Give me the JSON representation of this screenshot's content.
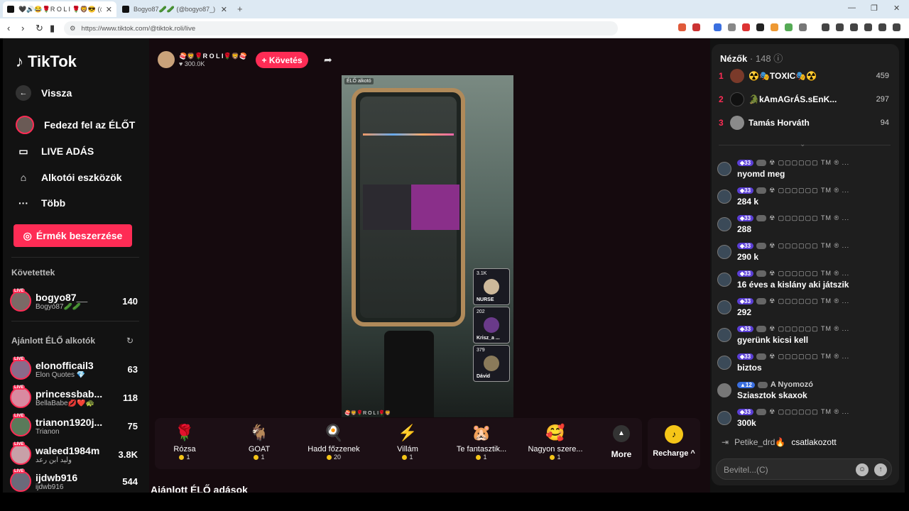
{
  "browser": {
    "tabs": [
      {
        "label": "🖤🔊😂🌹R O L I 🌹🦁😎 (@tiktok.roli)"
      },
      {
        "label": "Bogyo87🥒🥒 (@bogyo87_) ÉLŐ a"
      }
    ],
    "url": "https://www.tiktok.com/@tiktok.roli/live"
  },
  "sidebar": {
    "logo": "TikTok",
    "back": "Vissza",
    "menu": [
      {
        "label": "Fedezd fel az ÉLŐT"
      },
      {
        "label": "LIVE ADÁS"
      },
      {
        "label": "Alkotói eszközök"
      },
      {
        "label": "Több"
      }
    ],
    "coins_button": "Érmék beszerzése",
    "following_title": "Követettek",
    "following": [
      {
        "name": "bogyo87__",
        "sub": "Bogyó87🥒🥒",
        "count": "140"
      }
    ],
    "recommended_title": "Ajánlott ÉLŐ alkotók",
    "live_badge": "LIVE",
    "recommended": [
      {
        "name": "elonofficail3",
        "sub": "Elon Quotes 💎",
        "count": "63"
      },
      {
        "name": "princessbab...",
        "sub": "BellaBabe💋❤️🐢",
        "count": "118"
      },
      {
        "name": "trianon1920j...",
        "sub": "Trianon",
        "count": "75"
      },
      {
        "name": "waleed1984m",
        "sub": "وليد ابن رعد",
        "count": "3.8K"
      },
      {
        "name": "ijdwb916",
        "sub": "ijdwb916",
        "count": "544"
      }
    ]
  },
  "stream": {
    "streamer_name": "🍣🦁🌹R O L I🌹🦁🍣",
    "likes": "300.0K",
    "follow_button": "+ Követés",
    "video_badge": "ÉLŐ alkotó",
    "video_footer": "🍣🦁🌹R O L I🌹🦁",
    "guests": [
      {
        "count": "3.1K",
        "name": "NURSE"
      },
      {
        "count": "202",
        "name": "Krisz_a ..."
      },
      {
        "count": "379",
        "name": "Dávid"
      }
    ],
    "gifts": [
      {
        "name": "Rózsa",
        "price": "1",
        "icon": "🌹"
      },
      {
        "name": "GOAT",
        "price": "1",
        "icon": "🐐"
      },
      {
        "name": "Hadd főzzenek",
        "price": "20",
        "icon": "🍳"
      },
      {
        "name": "Villám",
        "price": "1",
        "icon": "⚡"
      },
      {
        "name": "Te fantasztik...",
        "price": "1",
        "icon": "🐹"
      },
      {
        "name": "Nagyon szere...",
        "price": "1",
        "icon": "🥰"
      }
    ],
    "more_label": "More",
    "recharge_label": "Recharge ^",
    "section_title": "Ajánlott ÉLŐ adások"
  },
  "panel": {
    "viewers_title": "Nézők",
    "viewers_count": "· 148",
    "top_viewers": [
      {
        "rank": "1",
        "name": "☢️🎭TOXIC🎭☢️",
        "value": "459"
      },
      {
        "rank": "2",
        "name": "🐊kAmAGrÁS.sEnK...",
        "value": "297"
      },
      {
        "rank": "3",
        "name": "Tamás Horváth",
        "value": "94"
      }
    ],
    "messages": [
      {
        "level": "33",
        "meta": "☢ ▢▢▢▢▢▢ TM ® ...",
        "text": "nyomd meg"
      },
      {
        "level": "33",
        "meta": "☢ ▢▢▢▢▢▢ TM ® ...",
        "text": "284 k"
      },
      {
        "level": "33",
        "meta": "☢ ▢▢▢▢▢▢ TM ® ...",
        "text": "288"
      },
      {
        "level": "33",
        "meta": "☢ ▢▢▢▢▢▢ TM ® ...",
        "text": "290 k"
      },
      {
        "level": "33",
        "meta": "☢ ▢▢▢▢▢▢ TM ® ...",
        "text": "16 éves a kislány aki játszik"
      },
      {
        "level": "33",
        "meta": "☢ ▢▢▢▢▢▢ TM ® ...",
        "text": "292"
      },
      {
        "level": "33",
        "meta": "☢ ▢▢▢▢▢▢ TM ® ...",
        "text": "gyerünk kicsi kell"
      },
      {
        "level": "33",
        "meta": "☢ ▢▢▢▢▢▢ TM ® ...",
        "text": "biztos"
      },
      {
        "level": "12",
        "meta": "A Nyomozó",
        "text": "Sziasztok skaxok"
      },
      {
        "level": "33",
        "meta": "☢ ▢▢▢▢▢▢ TM ® ...",
        "text": "300k"
      }
    ],
    "joined_name": "Petike_drd🔥",
    "joined_text": "csatlakozott",
    "input_placeholder": "Bevitel...(C)"
  }
}
